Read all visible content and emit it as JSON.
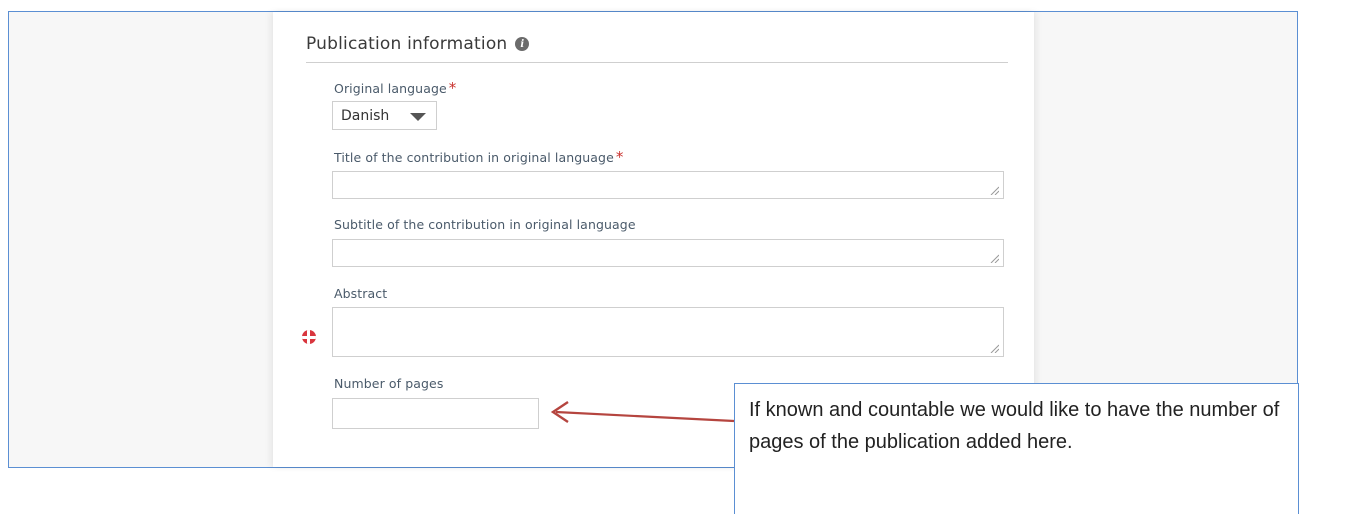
{
  "section": {
    "title": "Publication information",
    "info_icon": "info-icon"
  },
  "fields": {
    "original_language": {
      "label": "Original language",
      "required_mark": "*",
      "selected": "Danish"
    },
    "title": {
      "label": "Title of the contribution in original language",
      "required_mark": "*",
      "value": ""
    },
    "subtitle": {
      "label": "Subtitle of the contribution in original language",
      "value": ""
    },
    "abstract": {
      "label": "Abstract",
      "language_flag_icon": "danish-flag-icon",
      "value": ""
    },
    "pages": {
      "label": "Number of pages",
      "value": ""
    }
  },
  "callout": {
    "text": "If known and countable we would like to have the number of pages of the publication added here."
  },
  "colors": {
    "frame_border": "#5b8fd3",
    "required": "#c9302c",
    "arrow": "#b5453f"
  }
}
